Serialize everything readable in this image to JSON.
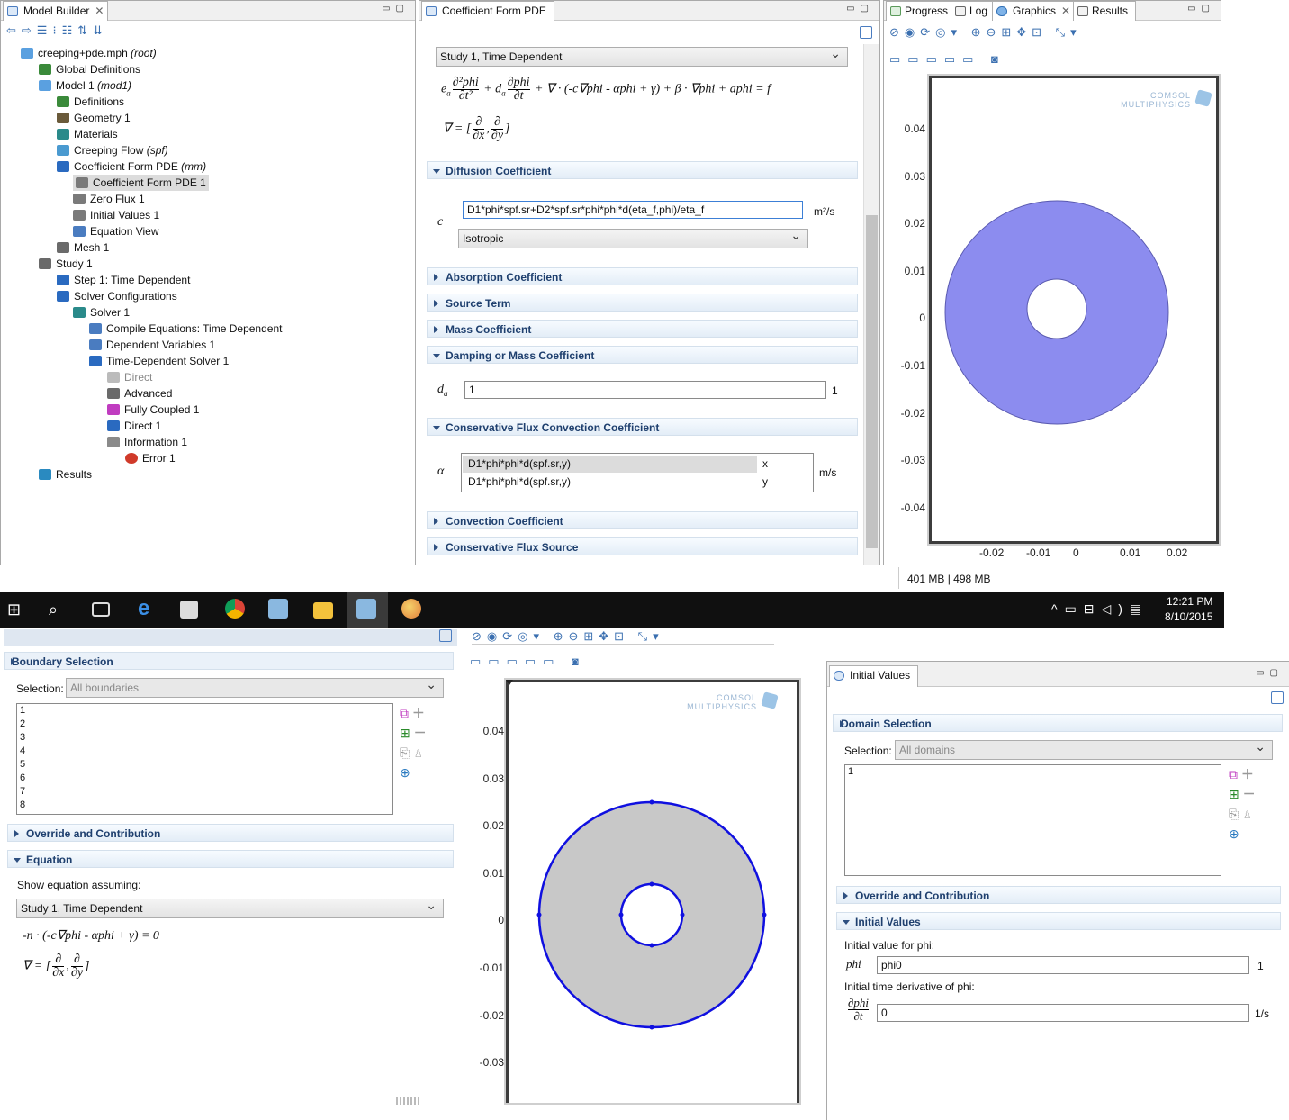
{
  "model_builder": {
    "title": "Model Builder",
    "tree": [
      {
        "label": "creeping+pde.mph",
        "suffix": "(root)"
      },
      {
        "label": "Global Definitions"
      },
      {
        "label": "Model 1",
        "suffix": "(mod1)"
      },
      {
        "label": "Definitions"
      },
      {
        "label": "Geometry 1"
      },
      {
        "label": "Materials"
      },
      {
        "label": "Creeping Flow",
        "suffix": "(spf)"
      },
      {
        "label": "Coefficient Form PDE",
        "suffix": "(mm)"
      },
      {
        "label": "Coefficient Form PDE 1"
      },
      {
        "label": "Zero Flux 1"
      },
      {
        "label": "Initial Values 1"
      },
      {
        "label": "Equation View"
      },
      {
        "label": "Mesh 1"
      },
      {
        "label": "Study 1"
      },
      {
        "label": "Step 1: Time Dependent"
      },
      {
        "label": "Solver Configurations"
      },
      {
        "label": "Solver 1"
      },
      {
        "label": "Compile Equations: Time Dependent"
      },
      {
        "label": "Dependent Variables 1"
      },
      {
        "label": "Time-Dependent Solver 1"
      },
      {
        "label": "Direct"
      },
      {
        "label": "Advanced"
      },
      {
        "label": "Fully Coupled 1"
      },
      {
        "label": "Direct 1"
      },
      {
        "label": "Information 1"
      },
      {
        "label": "Error 1"
      },
      {
        "label": "Results"
      }
    ]
  },
  "coef_panel": {
    "title": "Coefficient Form PDE",
    "study_select": "Study 1, Time Dependent",
    "eq_main": "e_a ∂²phi/∂t² + d_a ∂phi/∂t + ∇ · (-c∇phi - αphi + γ) + β · ∇phi + aphi = f",
    "eq_nabla": "∇ = [∂/∂x, ∂/∂y]",
    "sections": {
      "diffusion": "Diffusion Coefficient",
      "absorption": "Absorption Coefficient",
      "source": "Source Term",
      "mass": "Mass Coefficient",
      "damping": "Damping or Mass Coefficient",
      "cons_flux_conv": "Conservative Flux Convection Coefficient",
      "convection": "Convection Coefficient",
      "cons_flux_source": "Conservative Flux Source"
    },
    "c_symbol": "c",
    "c_value": "D1*phi*spf.sr+D2*spf.sr*phi*phi*d(eta_f,phi)/eta_f",
    "c_unit": "m²/s",
    "c_type": "Isotropic",
    "da_symbol": "d",
    "da_sub": "a",
    "da_value": "1",
    "da_unit": "1",
    "alpha_symbol": "α",
    "alpha_rows": [
      {
        "value": "D1*phi*phi*d(spf.sr,y)",
        "comp": "x"
      },
      {
        "value": "D1*phi*phi*d(spf.sr,y)",
        "comp": "y"
      }
    ],
    "alpha_unit": "m/s"
  },
  "graphics_panel": {
    "tabs": [
      "Progress",
      "Log",
      "Graphics",
      "Results"
    ],
    "logo_line1": "COMSOL",
    "logo_line2": "MULTIPHYSICS",
    "y_ticks": [
      "0.04",
      "0.03",
      "0.02",
      "0.01",
      "0",
      "-0.01",
      "-0.02",
      "-0.03",
      "-0.04"
    ],
    "x_ticks": [
      "-0.02",
      "-0.01",
      "0",
      "0.01",
      "0.02"
    ],
    "memory": "401 MB | 498 MB",
    "domain_color": "#8c8cef"
  },
  "taskbar": {
    "time": "12:21 PM",
    "date": "8/10/2015"
  },
  "boundary_panel": {
    "section": "Boundary Selection",
    "selection_label": "Selection:",
    "selection_value": "All boundaries",
    "items": [
      "1",
      "2",
      "3",
      "4",
      "5",
      "6",
      "7",
      "8"
    ],
    "override": "Override and Contribution",
    "equation": "Equation",
    "show_eq_label": "Show equation assuming:",
    "study_select": "Study 1, Time Dependent",
    "eq1": "-n · (-c∇phi - αphi + γ) = 0",
    "eq2": "∇ = [∂/∂x, ∂/∂y]"
  },
  "graphics2": {
    "logo_line1": "COMSOL",
    "logo_line2": "MULTIPHYSICS",
    "y_ticks": [
      "0.04",
      "0.03",
      "0.02",
      "0.01",
      "0",
      "-0.01",
      "-0.02",
      "-0.03"
    ],
    "boundary_color": "#1010e0",
    "domain_color": "#c8c8c8"
  },
  "initial_panel": {
    "title": "Initial Values",
    "section_domain": "Domain Selection",
    "selection_label": "Selection:",
    "selection_value": "All domains",
    "items": [
      "1"
    ],
    "override": "Override and Contribution",
    "section_initial": "Initial Values",
    "phi_label": "Initial value for phi:",
    "phi_symbol": "phi",
    "phi_value": "phi0",
    "phi_unit": "1",
    "dphi_label": "Initial time derivative of phi:",
    "dphi_num": "∂phi",
    "dphi_den": "∂t",
    "dphi_value": "0",
    "dphi_unit": "1/s"
  }
}
